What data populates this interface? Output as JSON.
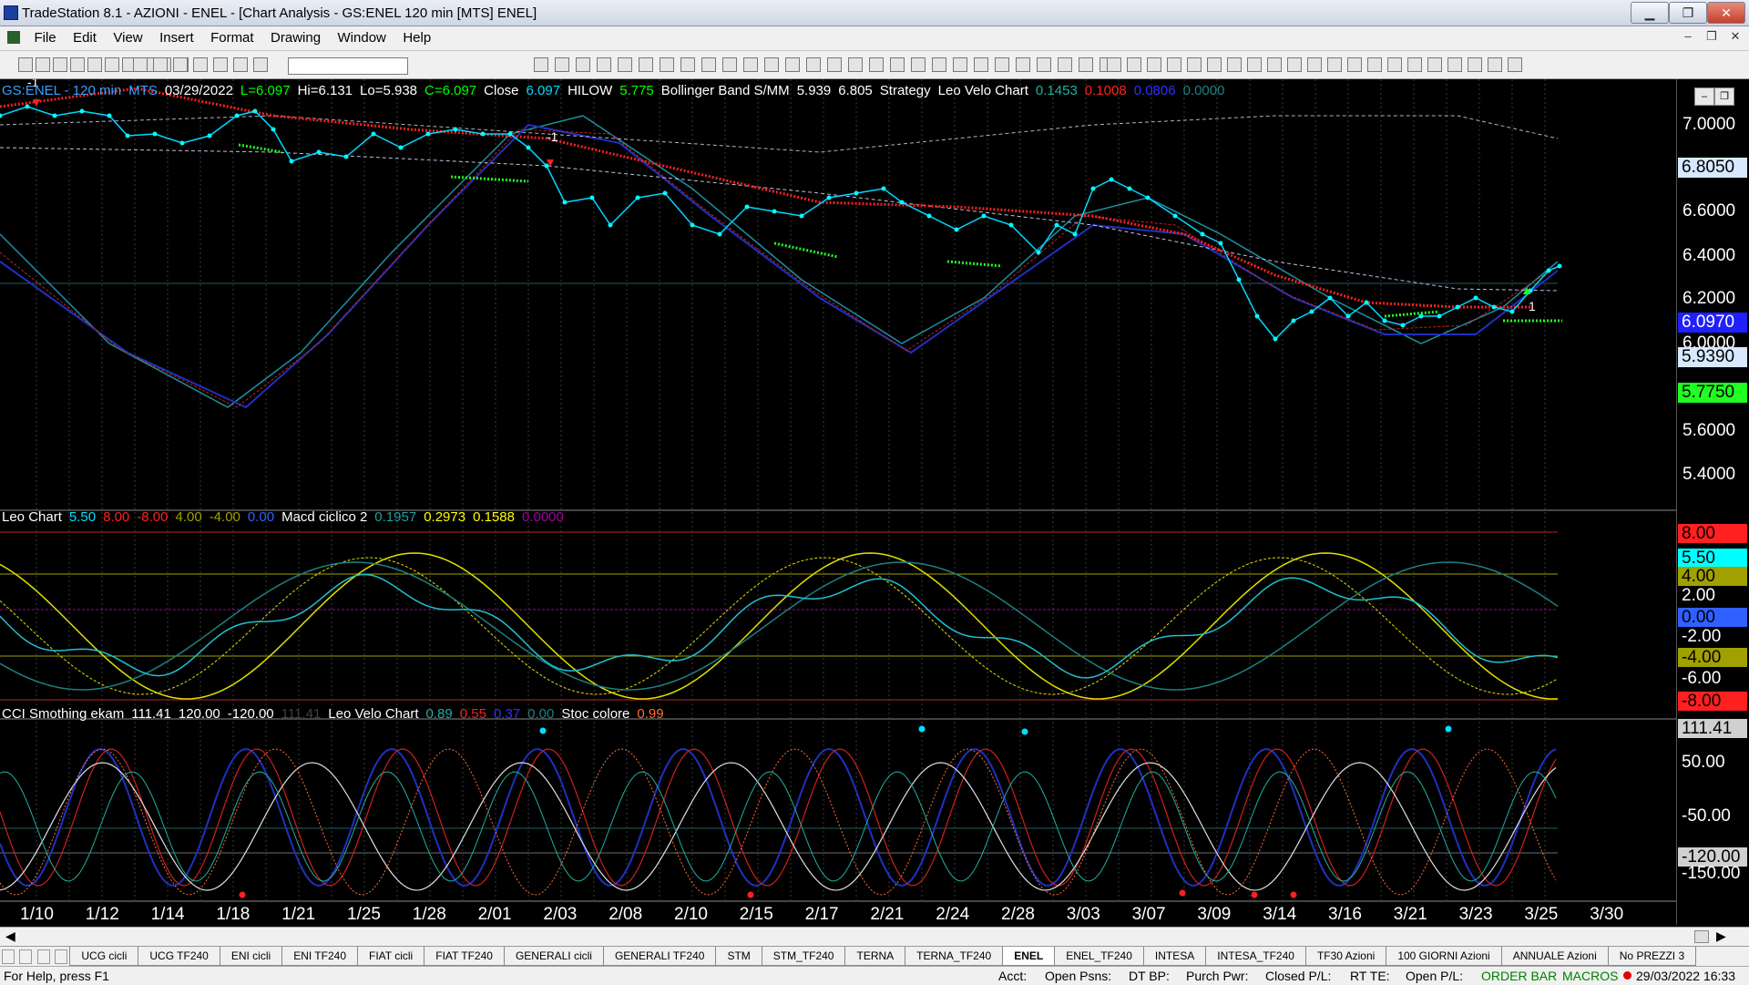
{
  "window": {
    "title": "TradeStation 8.1 - AZIONI - ENEL - [Chart Analysis - GS:ENEL  120 min  [MTS] ENEL]",
    "minimize": "▁",
    "restore": "❐",
    "close": "✕"
  },
  "menu": [
    "File",
    "Edit",
    "View",
    "Insert",
    "Format",
    "Drawing",
    "Window",
    "Help"
  ],
  "price_header": [
    {
      "text": "GS:ENEL - 120 min",
      "color": "#3aa0ff"
    },
    {
      "text": "MTS",
      "color": "#3aa0ff"
    },
    {
      "text": "03/29/2022",
      "color": "#ffffff"
    },
    {
      "text": "L=6.097",
      "color": "#00ff00"
    },
    {
      "text": "Hi=6.131",
      "color": "#ffffff"
    },
    {
      "text": "Lo=5.938",
      "color": "#ffffff"
    },
    {
      "text": "C=6.097",
      "color": "#00ff00"
    },
    {
      "text": "Close",
      "color": "#ffffff"
    },
    {
      "text": "6.097",
      "color": "#00d8ff"
    },
    {
      "text": "HILOW",
      "color": "#ffffff"
    },
    {
      "text": "5.775",
      "color": "#00ff00"
    },
    {
      "text": "Bollinger Band S/MM",
      "color": "#ffffff"
    },
    {
      "text": "5.939",
      "color": "#ffffff"
    },
    {
      "text": "6.805",
      "color": "#ffffff"
    },
    {
      "text": "Strategy",
      "color": "#ffffff"
    },
    {
      "text": "Leo Velo Chart",
      "color": "#ffffff"
    },
    {
      "text": "0.1453",
      "color": "#20b0a0"
    },
    {
      "text": "0.1008",
      "color": "#ff2020"
    },
    {
      "text": "0.0806",
      "color": "#3030ff"
    },
    {
      "text": "0.0000",
      "color": "#208080"
    }
  ],
  "osc_header": [
    {
      "text": "Leo Chart",
      "color": "#ffffff"
    },
    {
      "text": "5.50",
      "color": "#00e0ff"
    },
    {
      "text": "8.00",
      "color": "#ff2020"
    },
    {
      "text": "-8.00",
      "color": "#ff2020"
    },
    {
      "text": "4.00",
      "color": "#a0a000"
    },
    {
      "text": "-4.00",
      "color": "#a0a000"
    },
    {
      "text": "0.00",
      "color": "#3060ff"
    },
    {
      "text": "Macd ciclico 2",
      "color": "#ffffff"
    },
    {
      "text": "0.1957",
      "color": "#20a0a0"
    },
    {
      "text": "0.2973",
      "color": "#ffff00"
    },
    {
      "text": "0.1588",
      "color": "#ffff00"
    },
    {
      "text": "0.0000",
      "color": "#a000a0"
    }
  ],
  "cci_header": [
    {
      "text": "CCI Smothing ekam",
      "color": "#ffffff"
    },
    {
      "text": "111.41",
      "color": "#ffffff"
    },
    {
      "text": "120.00",
      "color": "#ffffff"
    },
    {
      "text": "-120.00",
      "color": "#ffffff"
    },
    {
      "text": "111.41",
      "color": "#404040"
    },
    {
      "text": "Leo Velo Chart",
      "color": "#ffffff"
    },
    {
      "text": "0.89",
      "color": "#20b0a0"
    },
    {
      "text": "0.55",
      "color": "#ff2020"
    },
    {
      "text": "0.37",
      "color": "#3030ff"
    },
    {
      "text": "0.00",
      "color": "#208080"
    },
    {
      "text": "Stoc colore",
      "color": "#ffffff"
    },
    {
      "text": "0.99",
      "color": "#ff7030"
    }
  ],
  "price_axis": [
    "7.0000",
    "6.6000",
    "6.4000",
    "6.2000",
    "6.0000",
    "5.6000",
    "5.4000"
  ],
  "price_flags": [
    {
      "text": "6.8050",
      "bg": "#d8e8ff",
      "fg": "#000000"
    },
    {
      "text": "6.0970",
      "bg": "#2020ff",
      "fg": "#ffffff"
    },
    {
      "text": "5.9390",
      "bg": "#d8e8ff",
      "fg": "#000000"
    },
    {
      "text": "5.7750",
      "bg": "#20ff20",
      "fg": "#000000"
    }
  ],
  "osc_axis": [
    {
      "text": "8.00",
      "bg": "#ff2020",
      "fg": "#000000"
    },
    {
      "text": "5.50",
      "bg": "#00ffff",
      "fg": "#000000"
    },
    {
      "text": "4.00",
      "bg": "#a0a000",
      "fg": "#000000"
    },
    {
      "text": "2.00",
      "bg": "",
      "fg": "#ffffff"
    },
    {
      "text": "0.00",
      "bg": "#3060ff",
      "fg": "#000000"
    },
    {
      "text": "-2.00",
      "bg": "",
      "fg": "#ffffff"
    },
    {
      "text": "-4.00",
      "bg": "#a0a000",
      "fg": "#000000"
    },
    {
      "text": "-6.00",
      "bg": "",
      "fg": "#ffffff"
    },
    {
      "text": "-8.00",
      "bg": "#ff2020",
      "fg": "#000000"
    }
  ],
  "cci_axis": [
    {
      "text": "111.41",
      "bg": "#d0d0d0",
      "fg": "#000000"
    },
    {
      "text": "50.00",
      "bg": "",
      "fg": "#ffffff"
    },
    {
      "text": "-50.00",
      "bg": "",
      "fg": "#ffffff"
    },
    {
      "text": "-120.00",
      "bg": "#d0d0d0",
      "fg": "#000000"
    },
    {
      "text": "-150.00",
      "bg": "",
      "fg": "#ffffff"
    }
  ],
  "x_axis": [
    "1/10",
    "1/12",
    "1/14",
    "1/18",
    "1/21",
    "1/25",
    "1/28",
    "2/01",
    "2/03",
    "2/08",
    "2/10",
    "2/15",
    "2/17",
    "2/21",
    "2/24",
    "2/28",
    "3/03",
    "3/07",
    "3/09",
    "3/14",
    "3/16",
    "3/21",
    "3/23",
    "3/25",
    "3/30"
  ],
  "tabs": [
    "UCG cicli",
    "UCG TF240",
    "ENI cicli",
    "ENI TF240",
    "FIAT cicli",
    "FIAT TF240",
    "GENERALI cicli",
    "GENERALI TF240",
    "STM",
    "STM_TF240",
    "TERNA",
    "TERNA_TF240",
    "ENEL",
    "ENEL_TF240",
    "INTESA",
    "INTESA_TF240",
    "TF30 Azioni",
    "100 GIORNI Azioni",
    "ANNUALE Azioni",
    "No PREZZI 3"
  ],
  "active_tab": "ENEL",
  "status": {
    "help": "For Help, press F1",
    "acct": "Acct:",
    "open_psns": "Open Psns:",
    "dtbp": "DT BP:",
    "purch": "Purch Pwr:",
    "closed": "Closed P/L:",
    "rte": "RT TE:",
    "openpl": "Open P/L:",
    "orderbar": "ORDER BAR",
    "macros": "MACROS",
    "datetime": "29/03/2022 16:33"
  },
  "strategy_markers": [
    "-1",
    "-1",
    "1",
    "1"
  ],
  "colors": {
    "accent": "#00d8ff",
    "bg": "#000000"
  }
}
